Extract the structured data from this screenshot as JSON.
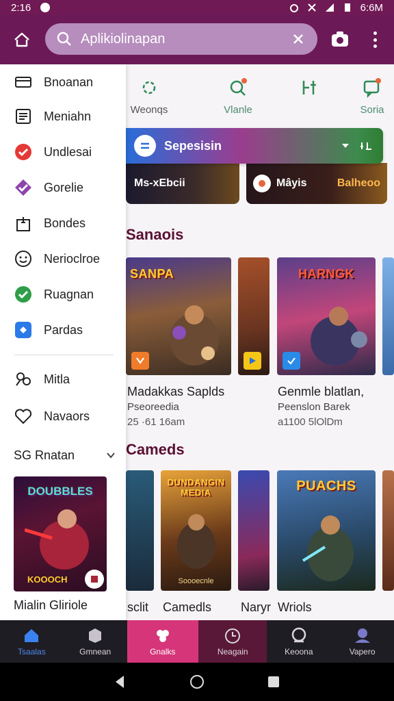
{
  "status_bar": {
    "time": "2:16",
    "clock_right": "6:6M"
  },
  "search": {
    "value": "Aplikiolinapan"
  },
  "drawer": {
    "items": [
      {
        "label": "Bnoanan",
        "icon": "card-icon"
      },
      {
        "label": "Meniahn",
        "icon": "list-icon"
      },
      {
        "label": "Undlesai",
        "icon": "check-red-icon"
      },
      {
        "label": "Gorelie",
        "icon": "check-purple-icon"
      },
      {
        "label": "Bondes",
        "icon": "gift-icon"
      },
      {
        "label": "Nerioclroe",
        "icon": "smile-icon"
      },
      {
        "label": "Ruagnan",
        "icon": "check-green-icon"
      },
      {
        "label": "Pardas",
        "icon": "puzzle-icon"
      },
      {
        "label": "Mitla",
        "icon": "people-icon"
      },
      {
        "label": "Navaors",
        "icon": "heart-icon"
      }
    ],
    "section_label": "SG Rnatan",
    "card": {
      "art_text": "DOUBBLES",
      "bottom_text": "KOOOCH"
    },
    "card_title": "Mialin Gliriole"
  },
  "categories": [
    {
      "label": "Weonqs",
      "icon": "gear-flower-icon"
    },
    {
      "label": "Vlanle",
      "icon": "search-badge-icon"
    },
    {
      "label": "",
      "icon": "tune-icon"
    },
    {
      "label": "Soria",
      "icon": "chat-badge-icon"
    }
  ],
  "banner": {
    "label": "Sepesisin"
  },
  "promos": {
    "left": "Ms-xEbcii",
    "right": "Mâyis",
    "right_tail": "Balheoo"
  },
  "sections": {
    "first": "Sanaois",
    "second": "Cameds"
  },
  "games_row1": [
    {
      "art_title": "SANPA",
      "title": "Madakkas Saplds",
      "sub": "Pseoreedia",
      "meta": "25 ·61 16am"
    },
    {
      "art_title": "HARNGK",
      "title": "Genmle blatlan,",
      "sub": "Peenslon Barek",
      "meta": "a1100 5lOlDm"
    }
  ],
  "games_row2": [
    {
      "art_title": "",
      "title": "",
      "title_hint": "sclit"
    },
    {
      "art_title": "DUNDANGIN MEDIA",
      "art_footer": "Soooecnle",
      "title": "Camedls"
    },
    {
      "art_title": "",
      "title": "Naryr"
    },
    {
      "art_title": "PUACHS",
      "title": "Wriols"
    }
  ],
  "bottom_nav": [
    {
      "label": "Tsaalas",
      "icon": "home-icon"
    },
    {
      "label": "Gmnean",
      "icon": "box-icon"
    },
    {
      "label": "Gnalks",
      "icon": "flower-icon"
    },
    {
      "label": "Neagain",
      "icon": "timer-icon"
    },
    {
      "label": "Keoona",
      "icon": "lens-icon"
    },
    {
      "label": "Vapero",
      "icon": "avatar-icon"
    }
  ],
  "colors": {
    "brand": "#6c1a57",
    "accent_green": "#2e8b57",
    "active_pink": "#d6357a"
  }
}
